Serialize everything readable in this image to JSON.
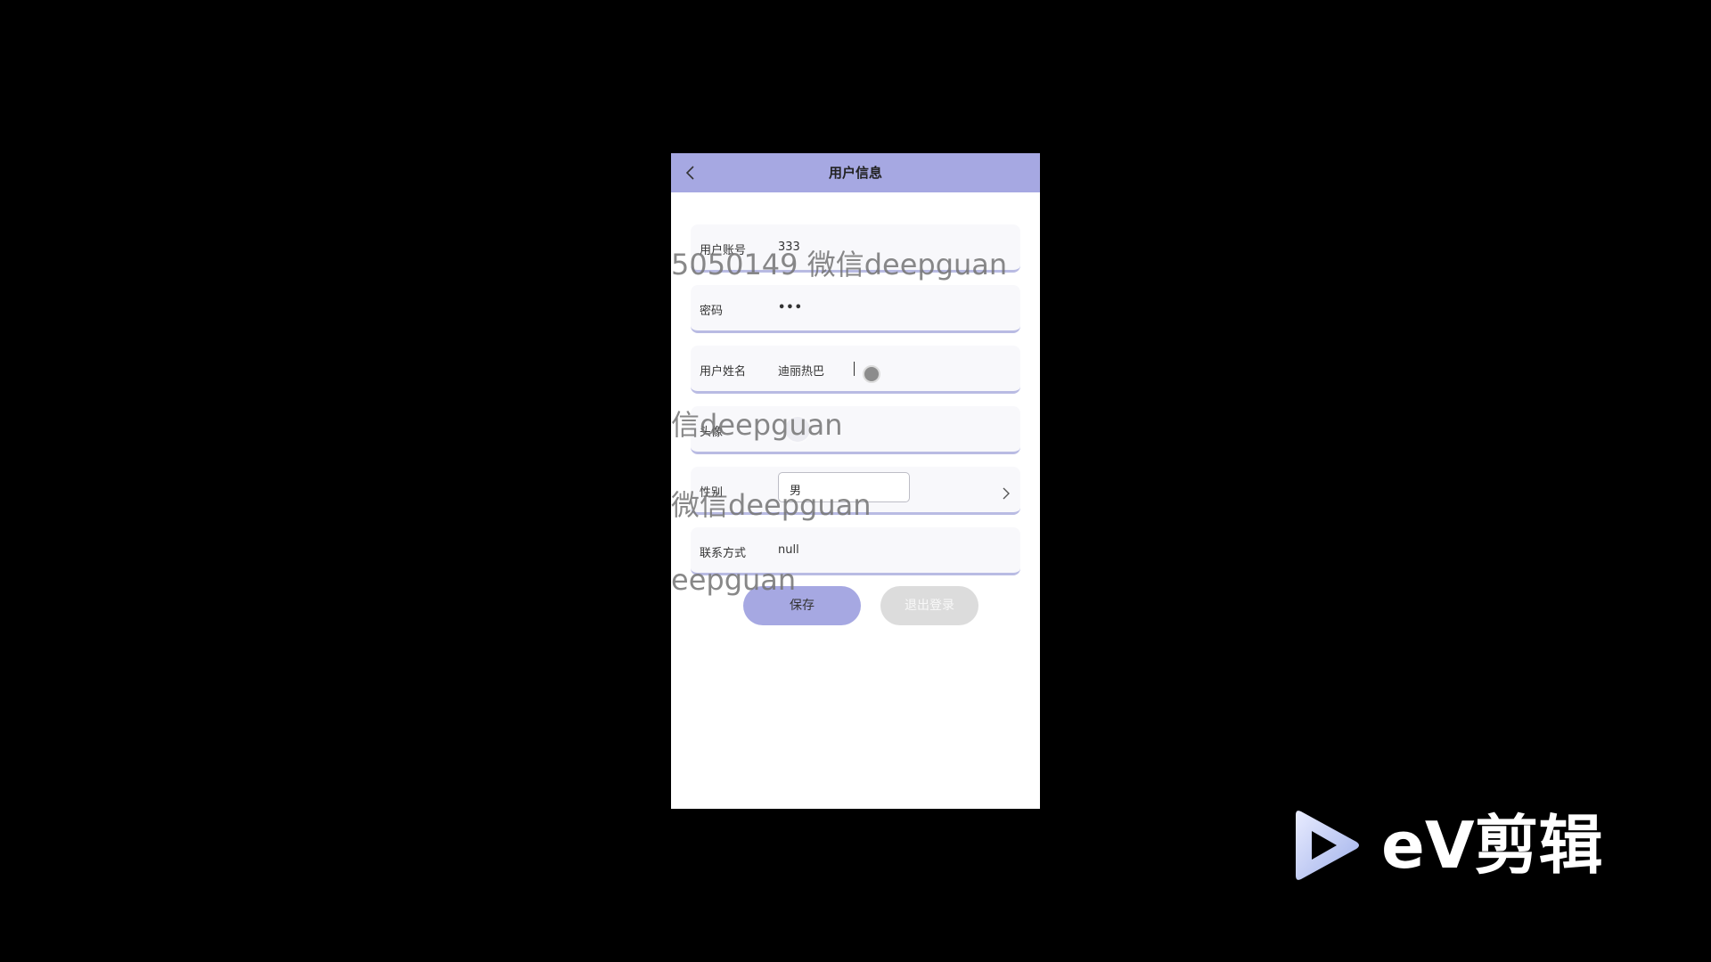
{
  "header": {
    "title": "用户信息"
  },
  "form": {
    "account": {
      "label": "用户账号",
      "value": "333"
    },
    "password": {
      "label": "密码",
      "value": "•••"
    },
    "name": {
      "label": "用户姓名",
      "value": "迪丽热巴"
    },
    "avatar": {
      "label": "头像"
    },
    "gender": {
      "label": "性别",
      "value": "男"
    },
    "contact": {
      "label": "联系方式",
      "value": "null"
    }
  },
  "buttons": {
    "save": "保存",
    "logout": "退出登录"
  },
  "watermarks": {
    "w1": "5050149 微信deepguan",
    "w2": "信deepguan",
    "w3": "微信deepguan",
    "w4": "eepguan"
  },
  "logo": {
    "text": "eV剪辑"
  },
  "colors": {
    "accent": "#a6a8e2",
    "background": "#000000",
    "button_disabled": "#dcdcdc"
  },
  "icons": {
    "back": "chevron-left-icon",
    "select": "chevron-right-icon",
    "logo": "play-icon"
  }
}
